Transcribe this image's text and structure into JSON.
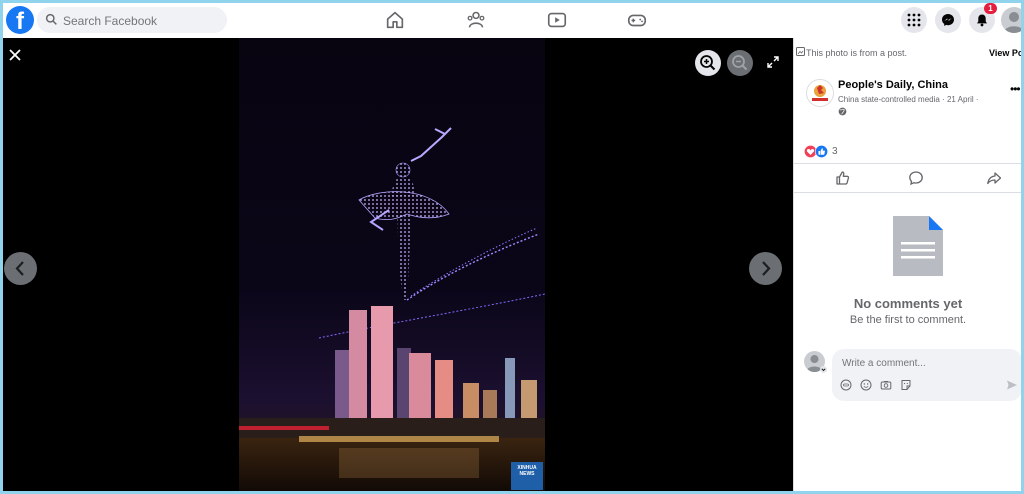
{
  "topbar": {
    "logo_letter": "f",
    "search_placeholder": "Search Facebook",
    "nav": [
      "home-icon",
      "friends-icon",
      "watch-icon",
      "gaming-icon"
    ],
    "notification_count": "1"
  },
  "viewer": {
    "watermark_line1": "XINHUA",
    "watermark_line2": "NEWS"
  },
  "panel": {
    "post_note": "This photo is from a post.",
    "view_post": "View Po",
    "page_name": "People's Daily, China",
    "page_meta": "China state-controlled media · 21 April ·",
    "reaction_count": "3",
    "no_comments_title": "No comments yet",
    "no_comments_sub": "Be the first to comment.",
    "comment_placeholder": "Write a comment..."
  },
  "colors": {
    "brand": "#1877f2",
    "badge": "#e41e3f"
  }
}
